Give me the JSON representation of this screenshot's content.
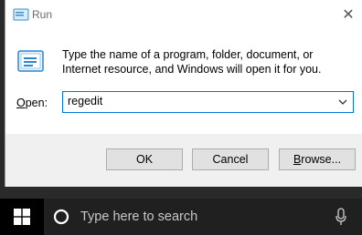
{
  "dialog": {
    "title": "Run",
    "close_symbol": "✕",
    "description": "Type the name of a program, folder, document, or Internet resource, and Windows will open it for you.",
    "open_label": {
      "prefix": "",
      "mnemonic": "O",
      "rest": "pen:"
    },
    "input_value": "regedit",
    "buttons": {
      "ok": "OK",
      "cancel": "Cancel",
      "browse": {
        "mnemonic": "B",
        "rest": "rowse..."
      }
    }
  },
  "taskbar": {
    "search_placeholder": "Type here to search"
  },
  "icons": {
    "title": "run-icon",
    "big": "run-icon",
    "dropdown": "chevron-down-icon",
    "start": "windows-logo-icon",
    "cortana": "cortana-circle-icon",
    "mic": "microphone-icon"
  },
  "colors": {
    "accent": "#0078d7",
    "taskbar": "#000000",
    "search_box": "#202020"
  }
}
